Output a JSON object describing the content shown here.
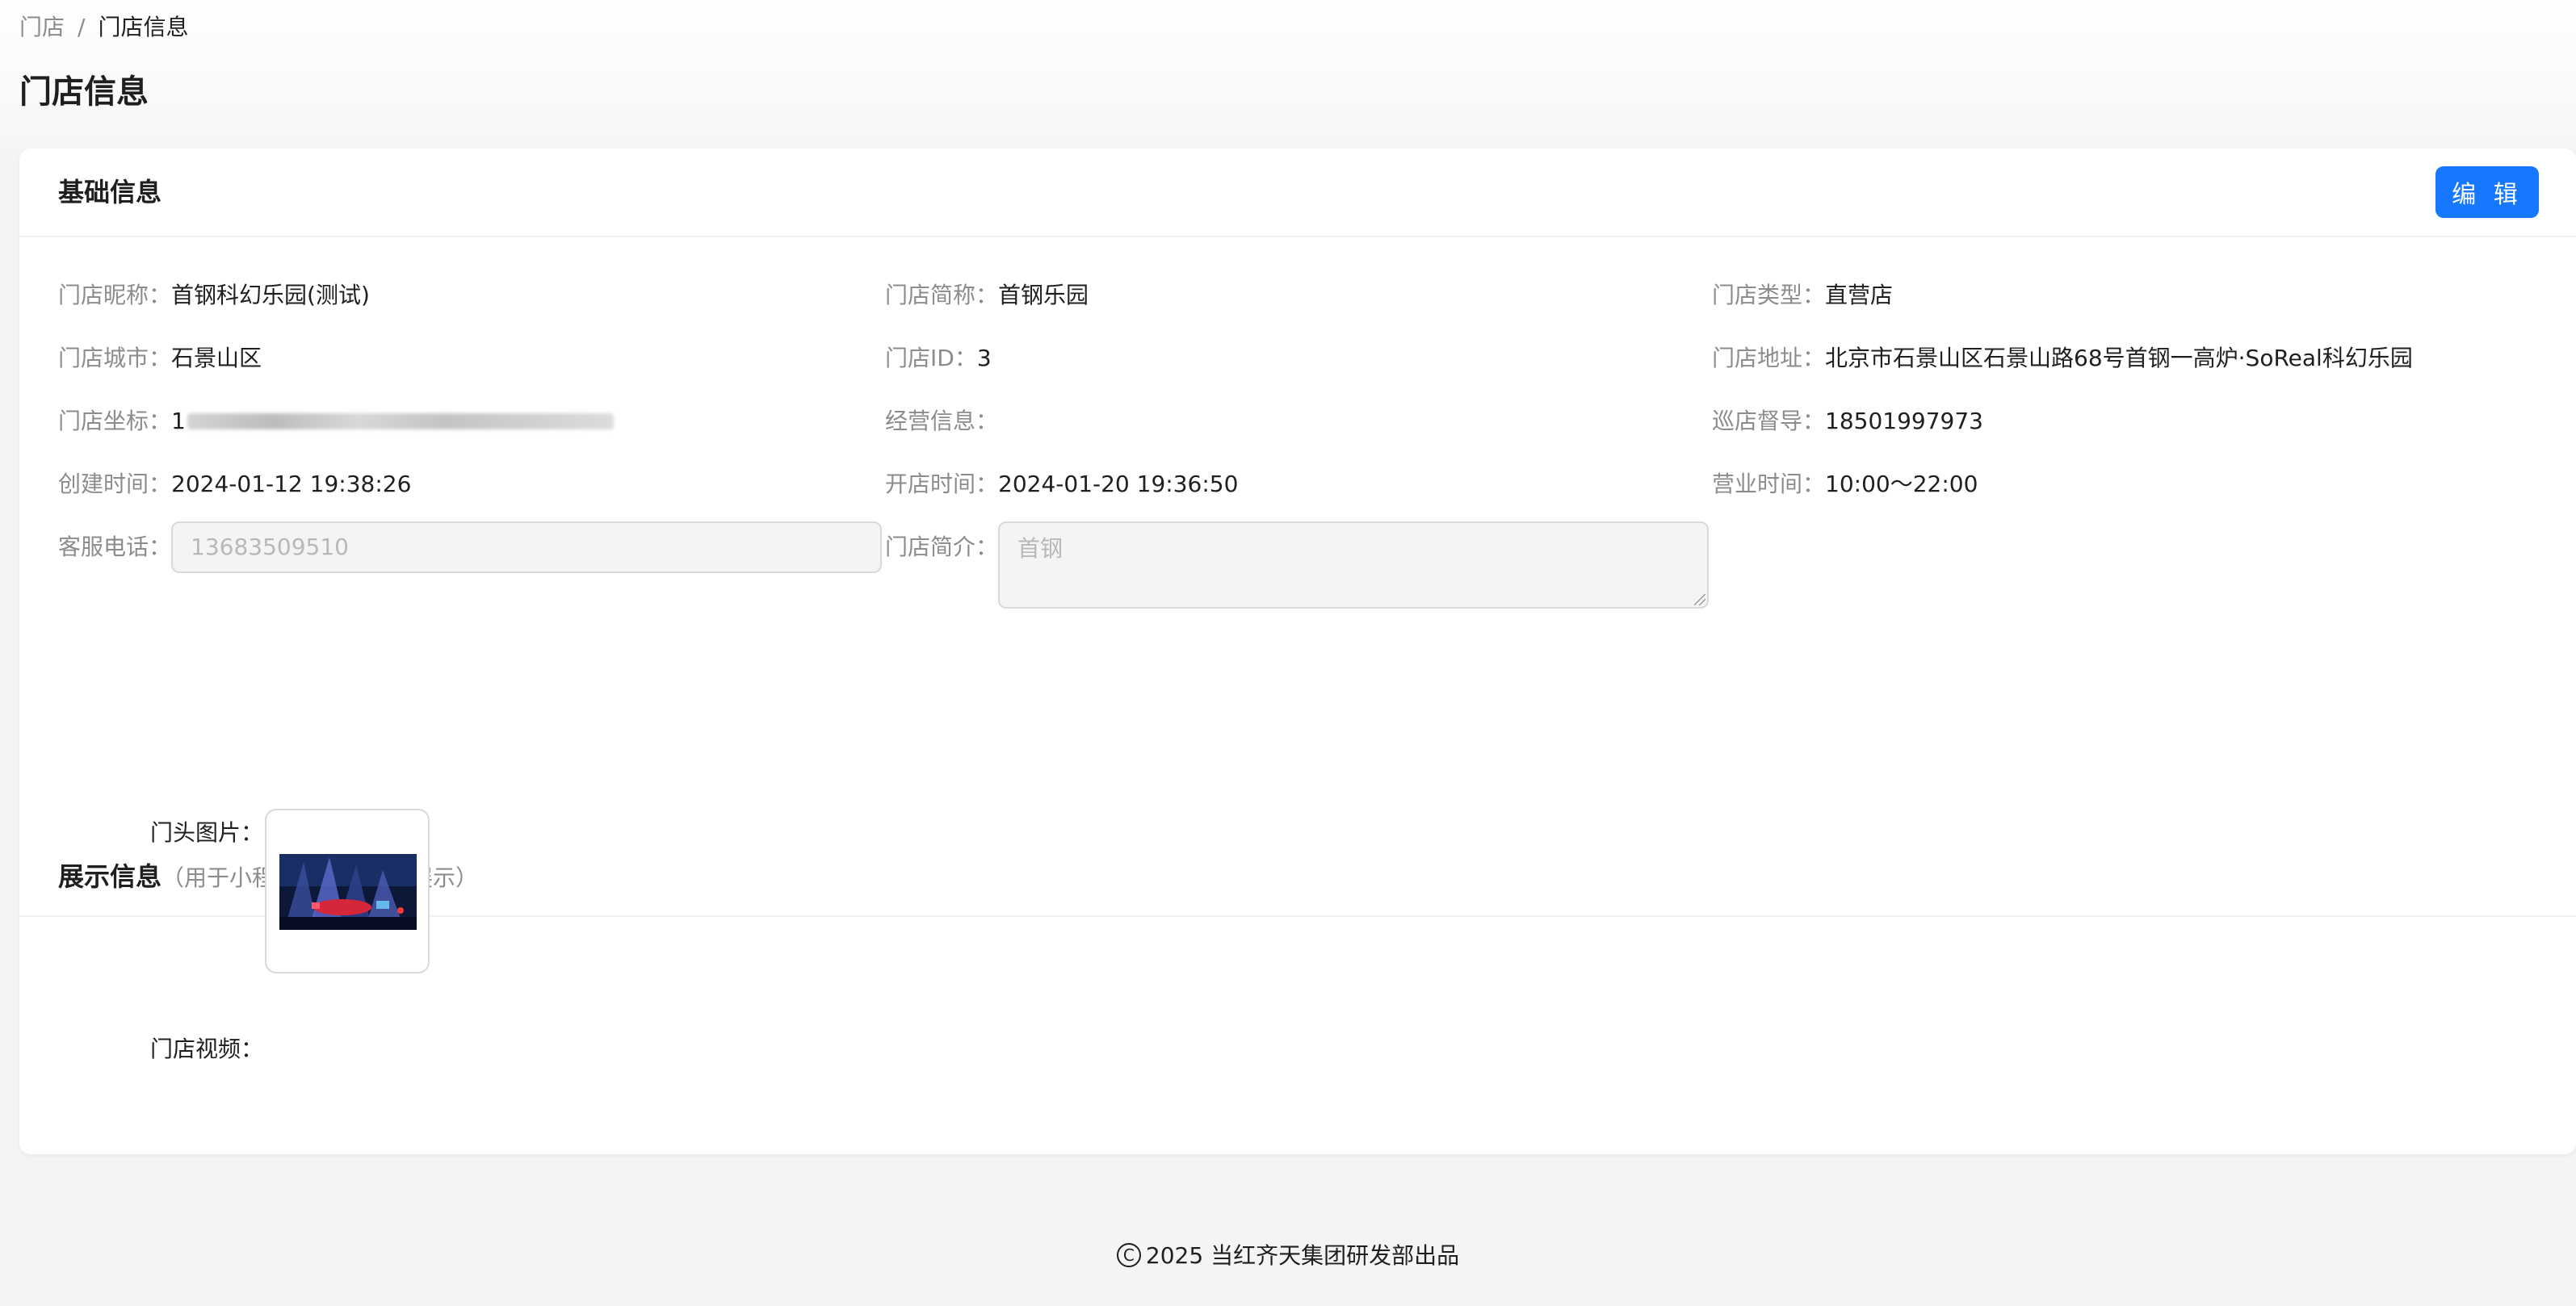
{
  "breadcrumb": {
    "root": "门店",
    "separator": "/",
    "current": "门店信息"
  },
  "page": {
    "title": "门店信息"
  },
  "basic_info": {
    "title": "基础信息",
    "edit_label": "编 辑",
    "fields": {
      "nickname": {
        "label": "门店昵称：",
        "value": "首钢科幻乐园(测试)"
      },
      "short_name": {
        "label": "门店简称：",
        "value": "首钢乐园"
      },
      "store_type": {
        "label": "门店类型：",
        "value": "直营店"
      },
      "city": {
        "label": "门店城市：",
        "value": "石景山区"
      },
      "store_id": {
        "label": "门店ID：",
        "value": "3"
      },
      "address": {
        "label": "门店地址：",
        "value": "北京市石景山区石景山路68号首钢一高炉·SoReal科幻乐园"
      },
      "coordinates": {
        "label": "门店坐标：",
        "value": "1"
      },
      "business_info": {
        "label": "经营信息：",
        "value": ""
      },
      "supervisor": {
        "label": "巡店督导：",
        "value": "18501997973"
      },
      "created_at": {
        "label": "创建时间：",
        "value": "2024-01-12 19:38:26"
      },
      "opened_at": {
        "label": "开店时间：",
        "value": "2024-01-20 19:36:50"
      },
      "business_hours": {
        "label": "营业时间：",
        "value": "10:00～22:00"
      },
      "service_phone": {
        "label": "客服电话：",
        "value": "13683509510"
      },
      "intro": {
        "label": "门店简介：",
        "value": "首钢"
      }
    }
  },
  "display_info": {
    "title": "展示信息",
    "note": "（用于小程序等平台对外展示）",
    "storefront_label": "门头图片：",
    "video_label": "门店视频："
  },
  "footer": {
    "icon": "copyright-icon",
    "text": "2025 当红齐天集团研发部出品"
  },
  "colors": {
    "accent": "#1677ff",
    "label": "#8c8c8c",
    "text": "#1f1f1f",
    "background": "#f4f4f4"
  }
}
